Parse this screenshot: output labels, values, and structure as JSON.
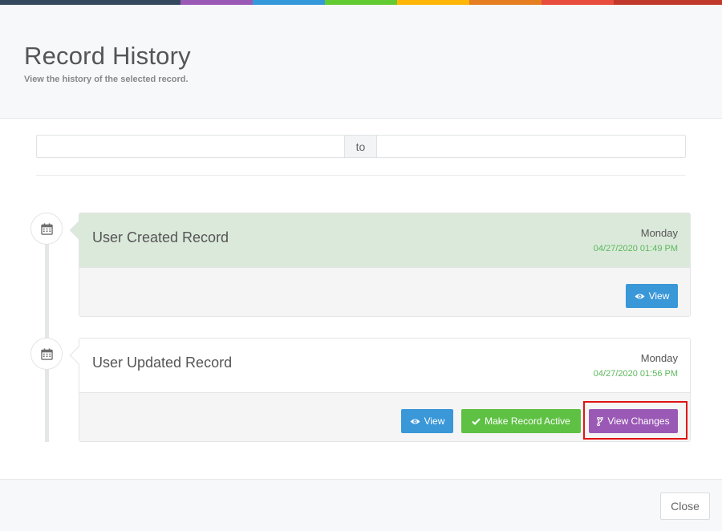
{
  "header": {
    "title": "Record History",
    "subtitle": "View the history of the selected record."
  },
  "color_bar": [
    "#34495e",
    "#9b59b6",
    "#3498db",
    "#62cb31",
    "#ffb606",
    "#e67e22",
    "#e74c3c",
    "#c0392b"
  ],
  "date_range": {
    "from_value": "",
    "separator": "to",
    "to_value": ""
  },
  "timeline": [
    {
      "icon": "calendar-icon",
      "title": "User Created Record",
      "day": "Monday",
      "datetime": "04/27/2020 01:49 PM",
      "highlighted": true,
      "buttons": [
        {
          "label": "View",
          "icon": "eye-icon",
          "color": "#3a97d8"
        }
      ]
    },
    {
      "icon": "calendar-icon",
      "title": "User Updated Record",
      "day": "Monday",
      "datetime": "04/27/2020 01:56 PM",
      "highlighted": false,
      "buttons": [
        {
          "label": "View",
          "icon": "eye-icon",
          "color": "#3a97d8"
        },
        {
          "label": "Make Record Active",
          "icon": "check-icon",
          "color": "#5fc144"
        },
        {
          "label": "View Changes",
          "icon": "code-fork-icon",
          "color": "#9b59b6"
        }
      ]
    }
  ],
  "footer": {
    "close_label": "Close"
  },
  "colors": {
    "accent_green_bg": "#dbe9da",
    "date_text": "#5cb85c",
    "highlight_box": "#e11313"
  }
}
